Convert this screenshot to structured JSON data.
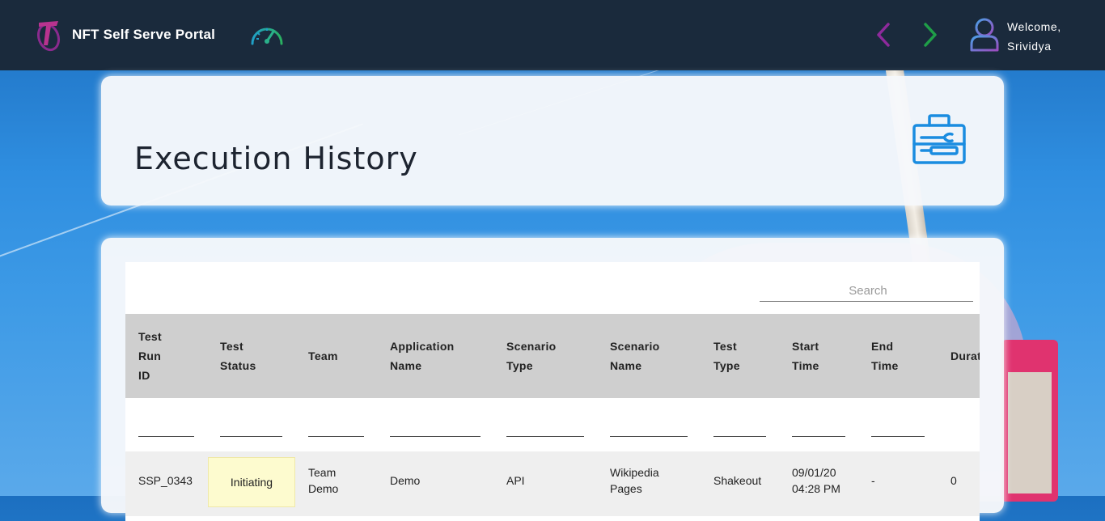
{
  "header": {
    "app_title": "NFT Self Serve Portal",
    "welcome_line1": "Welcome,",
    "welcome_line2": "Srividya",
    "colors": {
      "bar": "#1a2a3c",
      "back_arrow": "#8e2a9c",
      "forward_arrow": "#1f9e48"
    },
    "icons": [
      "telstra-logo-icon",
      "dashboard-gauge-icon",
      "back-arrow-icon",
      "forward-arrow-icon",
      "user-icon"
    ]
  },
  "page": {
    "title": "Execution History",
    "title_icon": "toolbox-icon"
  },
  "table": {
    "search_placeholder": "Search",
    "search_value": "",
    "columns": [
      {
        "l1": "Test",
        "l2": "Run",
        "l3": "ID"
      },
      {
        "l1": "Test",
        "l2": "Status"
      },
      {
        "l1": "Team"
      },
      {
        "l1": "Application",
        "l2": "Name"
      },
      {
        "l1": "Scenario",
        "l2": "Type"
      },
      {
        "l1": "Scenario",
        "l2": "Name"
      },
      {
        "l1": "Test",
        "l2": "Type"
      },
      {
        "l1": "Start",
        "l2": "Time"
      },
      {
        "l1": "End",
        "l2": "Time"
      },
      {
        "l1": "Durat"
      }
    ],
    "rows": [
      {
        "run_id": "SSP_0343",
        "status": "Initiating",
        "team_l1": "Team",
        "team_l2": "Demo",
        "application": "Demo",
        "scenario_type": "API",
        "scenario_name_l1": "Wikipedia",
        "scenario_name_l2": "Pages",
        "test_type": "Shakeout",
        "start_l1": "09/01/20",
        "start_l2": "04:28 PM",
        "end_time": "-",
        "duration": "0"
      }
    ]
  }
}
